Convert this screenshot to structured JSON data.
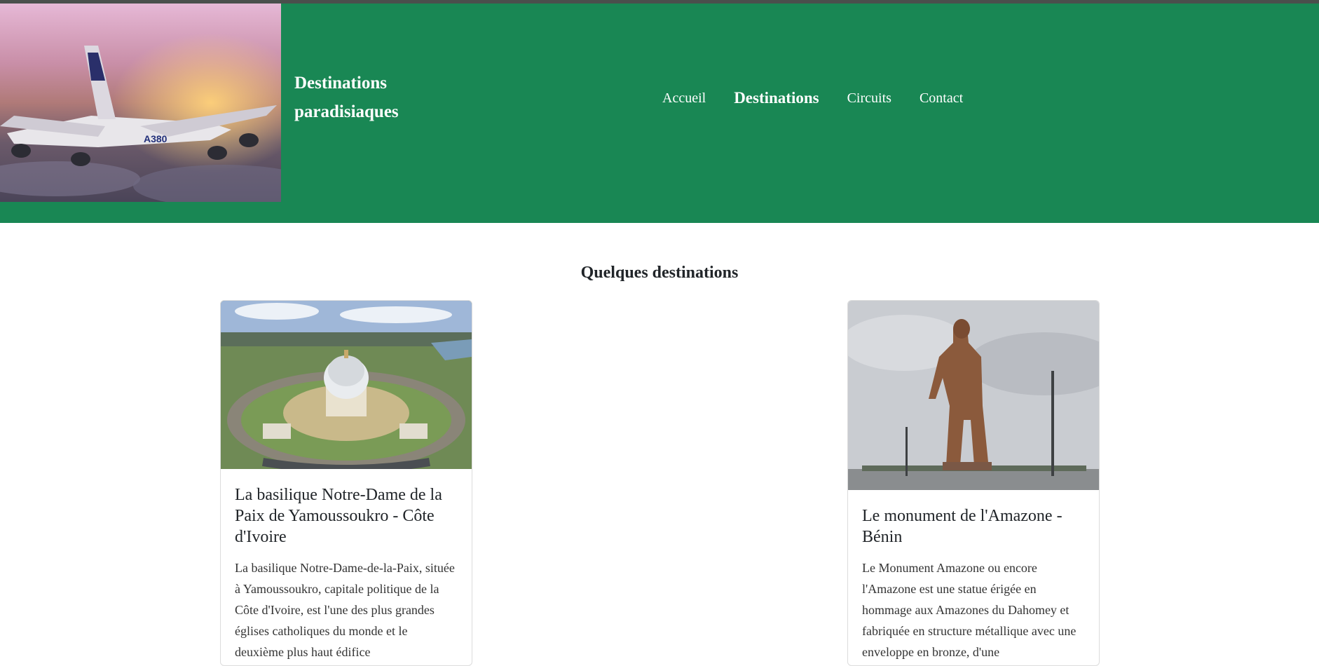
{
  "header": {
    "site_title": "Destinations paradisiaques",
    "background_color": "#198754",
    "hero_image": "airplane-over-clouds-sunset-photo"
  },
  "nav": {
    "items": [
      {
        "label": "Accueil",
        "active": false
      },
      {
        "label": "Destinations",
        "active": true
      },
      {
        "label": "Circuits",
        "active": false
      },
      {
        "label": "Contact",
        "active": false
      }
    ]
  },
  "main": {
    "section_title": "Quelques destinations",
    "cards": [
      {
        "image": "basilica-aerial-photo",
        "title": "La basilique Notre-Dame de la Paix de Yamoussoukro - Côte d'Ivoire",
        "text": "La basilique Notre-Dame-de-la-Paix, située à Yamoussoukro, capitale politique de la Côte d'Ivoire, est l'une des plus grandes églises catholiques du monde et le deuxième plus haut édifice"
      },
      {
        "image": "amazone-statue-photo",
        "title": "Le monument de l'Amazone - Bénin",
        "text": "Le Monument Amazone ou encore l'Amazone est une statue érigée en hommage aux Amazones du Dahomey et fabriquée en structure métallique avec une enveloppe en bronze, d'une"
      }
    ]
  }
}
